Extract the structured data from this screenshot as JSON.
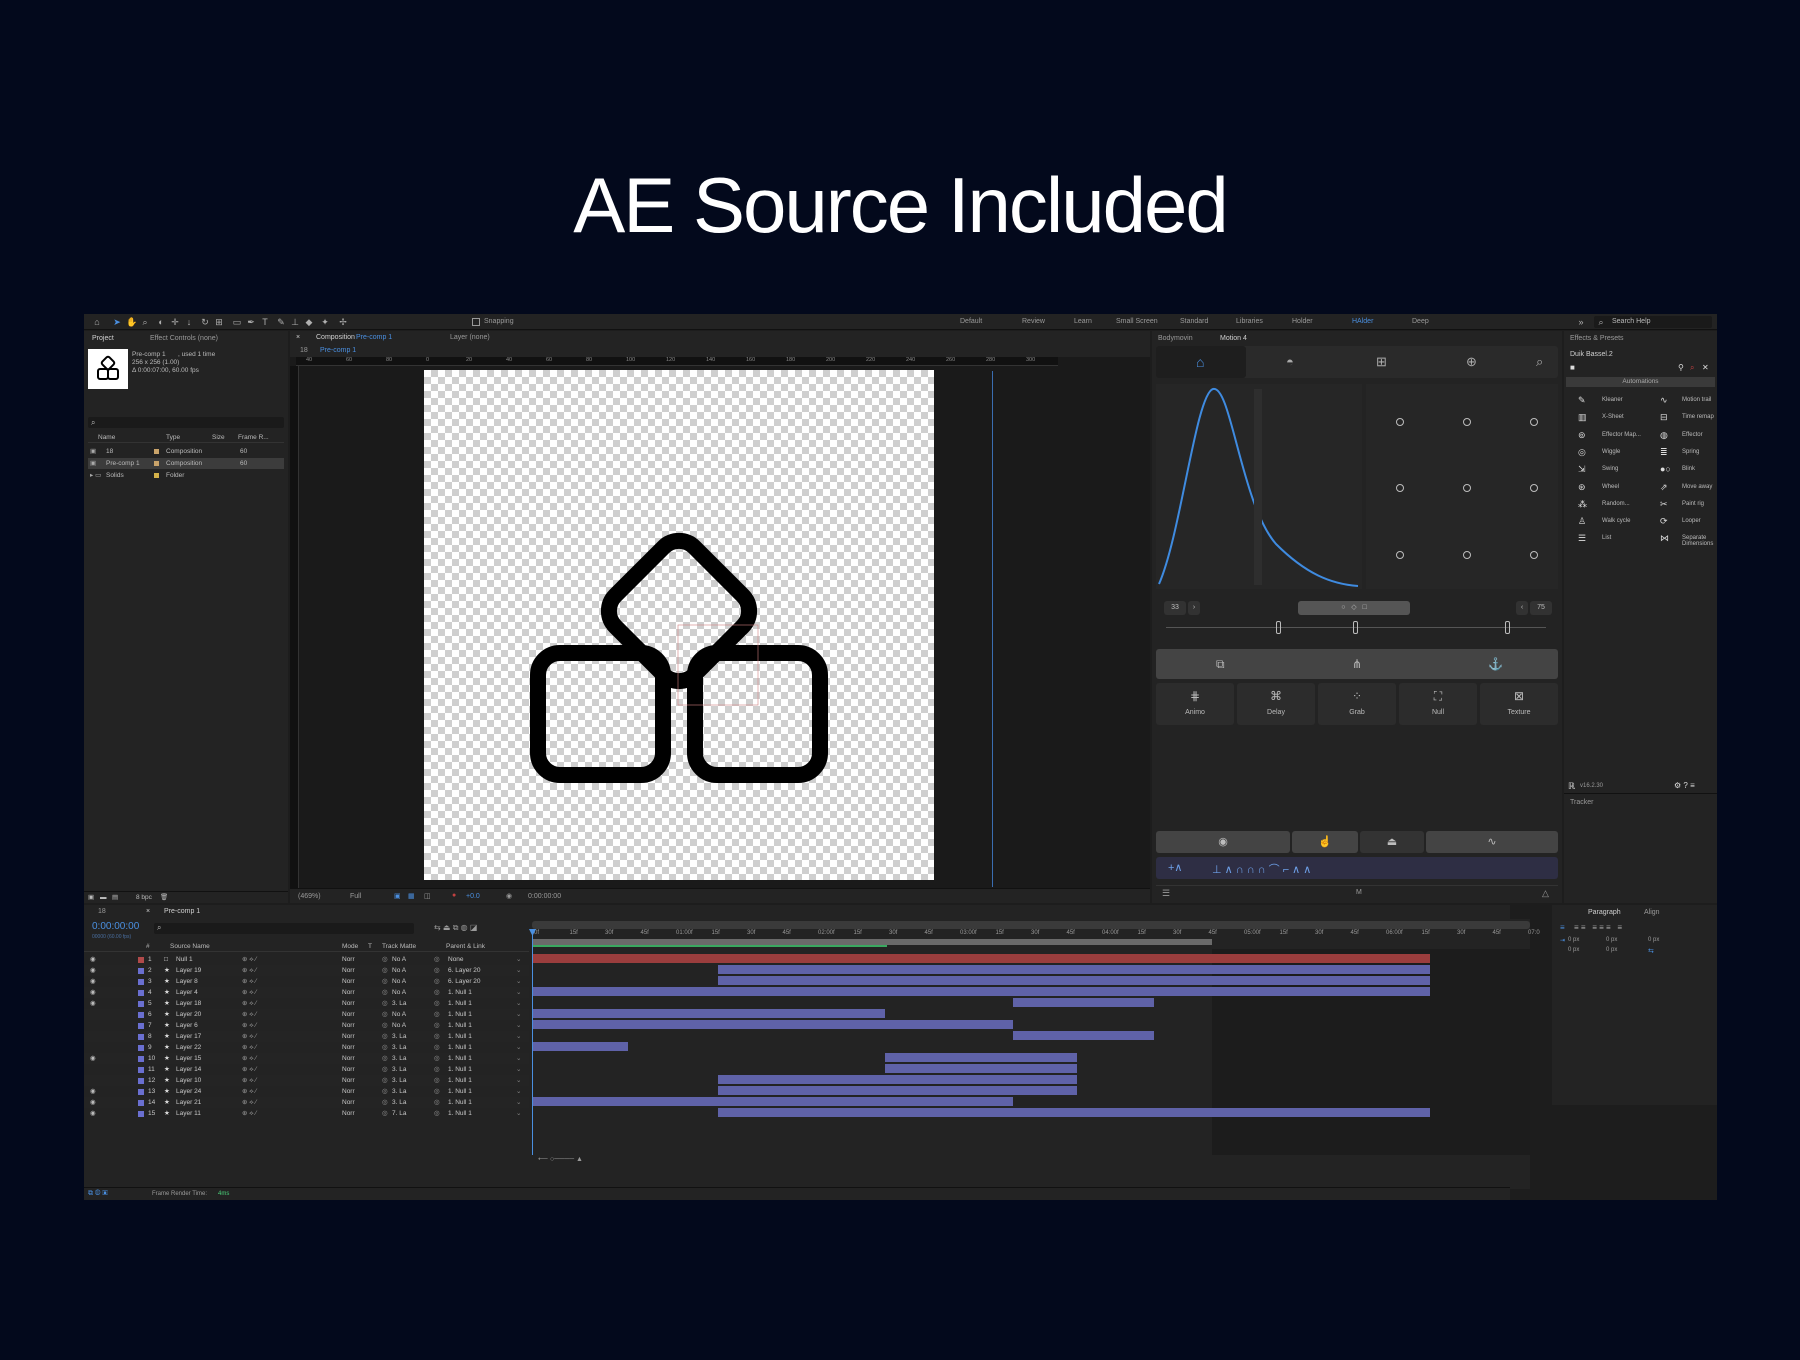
{
  "hero": {
    "title": "AE Source Included"
  },
  "toolbar": {
    "snapping_label": "Snapping",
    "workspaces": [
      "Default",
      "Review",
      "Learn",
      "Small Screen",
      "Standard",
      "Libraries",
      "Holder",
      "HAlder",
      "Deep"
    ],
    "active_workspace": "HAlder",
    "search_placeholder": "Search Help"
  },
  "project": {
    "tabs": [
      "Project",
      "Effect Controls (none)"
    ],
    "comp_name": "Pre-comp 1",
    "comp_used": ", used 1 time",
    "comp_size": "256 x 256 (1.00)",
    "comp_duration": "Δ 0:00:07:00, 60.00 fps",
    "columns": [
      "Name",
      "Type",
      "Size",
      "Frame R..."
    ],
    "items": [
      {
        "name": "18",
        "type": "Composition",
        "fps": "60"
      },
      {
        "name": "Pre-comp 1",
        "type": "Composition",
        "fps": "60"
      },
      {
        "name": "Solids",
        "type": "Folder",
        "fps": ""
      }
    ],
    "bpc": "8 bpc"
  },
  "comp": {
    "tab_prefix": "Composition",
    "tab_name": "Pre-comp 1",
    "layer_tab": "Layer (none)",
    "breadcrumb_a": "18",
    "breadcrumb_b": "Pre-comp 1",
    "ruler": [
      "40",
      "60",
      "80",
      "0",
      "20",
      "40",
      "60",
      "80",
      "100",
      "120",
      "140",
      "160",
      "180",
      "200",
      "220",
      "240",
      "260",
      "280",
      "300"
    ],
    "zoom": "(469%)",
    "quality": "Full",
    "exposure": "+0.0",
    "time": "0:00:00:00"
  },
  "motion": {
    "tabs": [
      "Bodymovin",
      "Motion 4"
    ],
    "left_value": "33",
    "right_value": "75",
    "tools": [
      "Animo",
      "Delay",
      "Grab",
      "Null",
      "Texture"
    ],
    "bottom_label": "M"
  },
  "duik": {
    "panel_tab": "Effects & Presets",
    "title": "Duik Bassel.2",
    "section": "Automations",
    "left_items": [
      "Kleaner",
      "X-Sheet",
      "Effector Map...",
      "Wiggle",
      "Swing",
      "Wheel",
      "Random...",
      "Walk cycle",
      "List"
    ],
    "right_items": [
      "Motion trail",
      "Time remap",
      "Effector",
      "Spring",
      "Blink",
      "Move away",
      "Paint rig",
      "Looper",
      "Separate Dimensions"
    ],
    "version": "v16.2.30",
    "tracker": "Tracker"
  },
  "timeline": {
    "tabs": [
      "18",
      "Pre-comp 1"
    ],
    "timecode": "0:00:00:00",
    "timecode_sub": "00000 (60.00 fps)",
    "columns": [
      "#",
      "Source Name",
      "Mode",
      "T",
      "Track Matte",
      "Parent & Link"
    ],
    "ruler": [
      "0f",
      "15f",
      "30f",
      "45f",
      "01:00f",
      "15f",
      "30f",
      "45f",
      "02:00f",
      "15f",
      "30f",
      "45f",
      "03:00f",
      "15f",
      "30f",
      "45f",
      "04:00f",
      "15f",
      "30f",
      "45f",
      "05:00f",
      "15f",
      "30f",
      "45f",
      "06:00f",
      "15f",
      "30f",
      "45f",
      "07:0"
    ],
    "layers": [
      {
        "n": "1",
        "name": "Null 1",
        "mode": "Norr",
        "matte": "No A",
        "parent": "None",
        "color": "#b04a4a"
      },
      {
        "n": "2",
        "name": "Layer 19",
        "mode": "Norr",
        "matte": "No A",
        "parent": "6. Layer 20",
        "color": "#6a6fd0"
      },
      {
        "n": "3",
        "name": "Layer 8",
        "mode": "Norr",
        "matte": "No A",
        "parent": "6. Layer 20",
        "color": "#6a6fd0"
      },
      {
        "n": "4",
        "name": "Layer 4",
        "mode": "Norr",
        "matte": "No A",
        "parent": "1. Null 1",
        "color": "#6a6fd0"
      },
      {
        "n": "5",
        "name": "Layer 18",
        "mode": "Norr",
        "matte": "3. La",
        "parent": "1. Null 1",
        "color": "#6a6fd0"
      },
      {
        "n": "6",
        "name": "Layer 20",
        "mode": "Norr",
        "matte": "No A",
        "parent": "1. Null 1",
        "color": "#6a6fd0"
      },
      {
        "n": "7",
        "name": "Layer 6",
        "mode": "Norr",
        "matte": "No A",
        "parent": "1. Null 1",
        "color": "#6a6fd0"
      },
      {
        "n": "8",
        "name": "Layer 17",
        "mode": "Norr",
        "matte": "3. La",
        "parent": "1. Null 1",
        "color": "#6a6fd0"
      },
      {
        "n": "9",
        "name": "Layer 22",
        "mode": "Norr",
        "matte": "3. La",
        "parent": "1. Null 1",
        "color": "#6a6fd0"
      },
      {
        "n": "10",
        "name": "Layer 15",
        "mode": "Norr",
        "matte": "3. La",
        "parent": "1. Null 1",
        "color": "#6a6fd0"
      },
      {
        "n": "11",
        "name": "Layer 14",
        "mode": "Norr",
        "matte": "3. La",
        "parent": "1. Null 1",
        "color": "#6a6fd0"
      },
      {
        "n": "12",
        "name": "Layer 10",
        "mode": "Norr",
        "matte": "3. La",
        "parent": "1. Null 1",
        "color": "#6a6fd0"
      },
      {
        "n": "13",
        "name": "Layer 24",
        "mode": "Norr",
        "matte": "3. La",
        "parent": "1. Null 1",
        "color": "#6a6fd0"
      },
      {
        "n": "14",
        "name": "Layer 21",
        "mode": "Norr",
        "matte": "3. La",
        "parent": "1. Null 1",
        "color": "#6a6fd0"
      },
      {
        "n": "15",
        "name": "Layer 11",
        "mode": "Norr",
        "matte": "7. La",
        "parent": "1. Null 1",
        "color": "#6a6fd0"
      }
    ],
    "bars": [
      {
        "start": 0,
        "end": 1
      },
      {
        "start": 0.207,
        "end": 1
      },
      {
        "start": 0.207,
        "end": 1
      },
      {
        "start": 0,
        "end": 1
      },
      {
        "start": 0.536,
        "end": 0.693
      },
      {
        "start": 0,
        "end": 0.393
      },
      {
        "start": 0,
        "end": 0.536
      },
      {
        "start": 0.536,
        "end": 0.693
      },
      {
        "start": 0,
        "end": 0.107
      },
      {
        "start": 0.393,
        "end": 0.607
      },
      {
        "start": 0.393,
        "end": 0.607
      },
      {
        "start": 0.207,
        "end": 0.607
      },
      {
        "start": 0.207,
        "end": 0.607
      },
      {
        "start": 0,
        "end": 0.536
      },
      {
        "start": 0.207,
        "end": 1
      }
    ],
    "work_area_end": 0.68,
    "render_label": "Frame Render Time:",
    "render_value": "4ms"
  },
  "paragraph": {
    "tabs": [
      "Paragraph",
      "Align"
    ],
    "px_values": [
      "0 px",
      "0 px",
      "0 px",
      "0 px",
      "0 px"
    ]
  }
}
